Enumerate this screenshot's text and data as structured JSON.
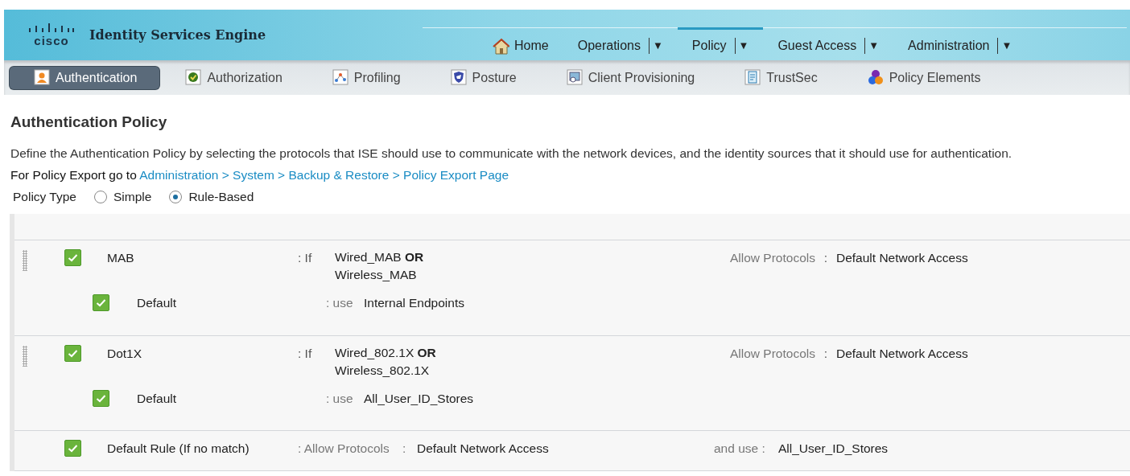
{
  "header": {
    "logo_text": "cisco",
    "title": "Identity Services Engine"
  },
  "main_nav": [
    {
      "label": "Home",
      "selected": false
    },
    {
      "label": "Operations",
      "caret": "▼",
      "selected": false
    },
    {
      "label": "Policy",
      "caret": "▼",
      "selected": true
    },
    {
      "label": "Guest Access",
      "caret": "▼",
      "selected": false
    },
    {
      "label": "Administration",
      "caret": "▼",
      "selected": false
    }
  ],
  "sub_nav": [
    {
      "label": "Authentication",
      "selected": true
    },
    {
      "label": "Authorization",
      "selected": false
    },
    {
      "label": "Profiling",
      "selected": false
    },
    {
      "label": "Posture",
      "selected": false
    },
    {
      "label": "Client Provisioning",
      "selected": false
    },
    {
      "label": "TrustSec",
      "selected": false
    },
    {
      "label": "Policy Elements",
      "selected": false
    }
  ],
  "page": {
    "title": "Authentication Policy",
    "description": "Define the Authentication Policy by selecting the protocols that ISE should use to communicate with the network devices, and the identity sources that it should use for authentication.",
    "export_prefix": "For Policy Export go to",
    "export_link": "Administration > System > Backup & Restore > Policy Export Page",
    "policy_type": {
      "label": "Policy Type",
      "options": [
        {
          "label": "Simple",
          "selected": false
        },
        {
          "label": "Rule-Based",
          "selected": true
        }
      ]
    }
  },
  "rules": [
    {
      "kind": "rule",
      "checked": true,
      "name": "MAB",
      "if_label": ": If",
      "conditions": [
        "Wired_MAB **OR**",
        "Wireless_MAB"
      ],
      "allow_label": "Allow Protocols",
      "separator": ":",
      "protocols": "Default Network Access",
      "sub_rules": [
        {
          "checked": true,
          "name": "Default",
          "use_label": ": use",
          "identity_source": "Internal Endpoints"
        }
      ]
    },
    {
      "kind": "rule",
      "checked": true,
      "name": "Dot1X",
      "if_label": ": If",
      "conditions": [
        "Wired_802.1X **OR**",
        "Wireless_802.1X"
      ],
      "allow_label": "Allow Protocols",
      "separator": ":",
      "protocols": "Default Network Access",
      "sub_rules": [
        {
          "checked": true,
          "name": "Default",
          "use_label": ": use",
          "identity_source": "All_User_ID_Stores"
        }
      ]
    },
    {
      "kind": "default",
      "checked": true,
      "name": "Default Rule (If no match)",
      "allow_label": ": Allow Protocols",
      "separator": ":",
      "protocols": "Default Network Access",
      "use_label": "and use :",
      "identity_source": "All_User_ID_Stores"
    }
  ]
}
